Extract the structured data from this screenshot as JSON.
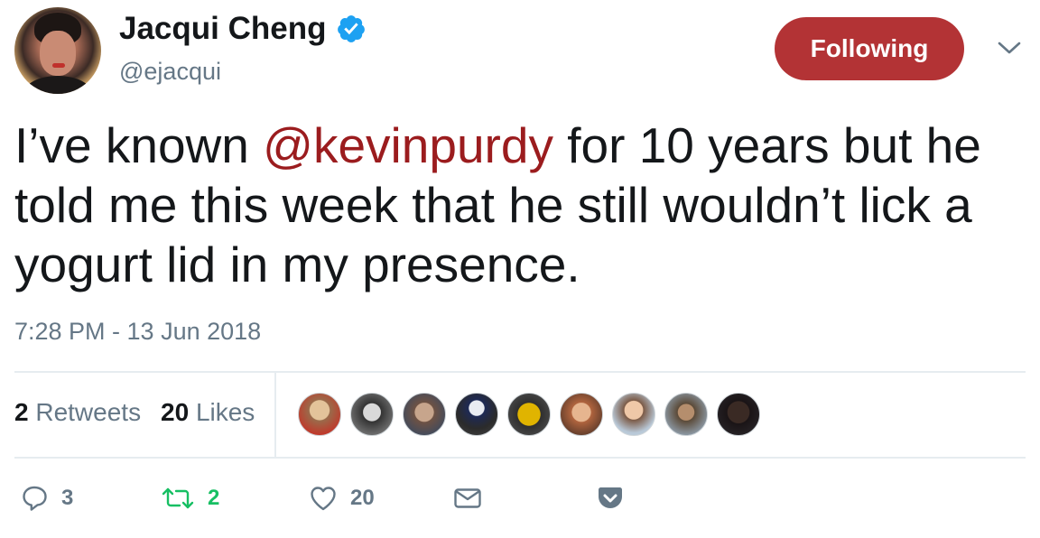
{
  "user": {
    "display_name": "Jacqui Cheng",
    "handle": "@ejacqui",
    "verified_icon": "verified-badge-icon",
    "avatar_icon": "profile-photo"
  },
  "follow_button": {
    "label": "Following",
    "color": "#b33335"
  },
  "tweet": {
    "text_before": "I’ve known ",
    "mention": "@kevinpurdy",
    "text_after": " for 10 years but he told me this week that he still wouldn’t lick a yogurt lid in my presence.",
    "mention_color": "#9b1c1e",
    "timestamp": "7:28 PM - 13 Jun 2018"
  },
  "stats": {
    "retweets_count": "2",
    "retweets_label": "Retweets",
    "likes_count": "20",
    "likes_label": "Likes"
  },
  "likers": [
    {
      "name": "liker-1"
    },
    {
      "name": "liker-2"
    },
    {
      "name": "liker-3"
    },
    {
      "name": "liker-4"
    },
    {
      "name": "liker-5"
    },
    {
      "name": "liker-6"
    },
    {
      "name": "liker-7"
    },
    {
      "name": "liker-8"
    },
    {
      "name": "liker-9"
    }
  ],
  "actions": {
    "reply_count": "3",
    "retweet_count": "2",
    "like_count": "20",
    "retweet_color": "#17bf63",
    "muted_color": "#657786"
  }
}
